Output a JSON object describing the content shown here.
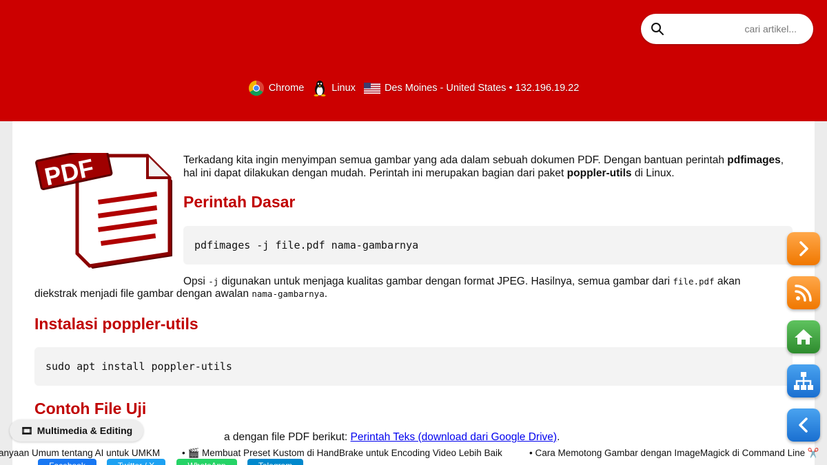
{
  "search": {
    "placeholder": "cari artikel..."
  },
  "visitor": {
    "browser": "Chrome",
    "os": "Linux",
    "location": "Des Moines - United States • 132.196.19.22"
  },
  "article": {
    "intro_text_1": "Terkadang kita ingin menyimpan semua gambar yang ada dalam sebuah dokumen PDF. Dengan bantuan perintah ",
    "intro_bold_1": "pdfimages",
    "intro_text_2": ", hal ini dapat dilakukan dengan mudah. Perintah ini merupakan bagian dari paket ",
    "intro_bold_2": "poppler-utils",
    "intro_text_3": " di Linux.",
    "heading_dasar": "Perintah Dasar",
    "code_dasar": "pdfimages -j file.pdf nama-gambarnya",
    "para2_t1": "Opsi ",
    "para2_c1": "-j",
    "para2_t2": " digunakan untuk menjaga kualitas gambar dengan format JPEG. Hasilnya, semua gambar dari ",
    "para2_c2": "file.pdf",
    "para2_t3": " akan",
    "para2_t4": "diekstrak menjadi file gambar dengan awalan ",
    "para2_c3": "nama-gambarnya",
    "para2_t5": ".",
    "heading_install": "Instalasi poppler-utils",
    "code_install": "sudo apt install poppler-utils",
    "heading_contoh": "Contoh File Uji",
    "para3_text": "a dengan file PDF berikut: ",
    "para3_link": "Perintah Teks (download dari Google Drive)",
    "para3_end": "."
  },
  "category_badge": {
    "icon": "🎞",
    "label": "Multimedia & Editing"
  },
  "ticker": [
    "anyaan Umum tentang AI untuk UMKM",
    "• 🎬 Membuat Preset Kustom di HandBrake untuk Encoding Video Lebih Baik",
    "• Cara Memotong Gambar dengan ImageMagick di Command Line ✂️"
  ],
  "share": {
    "facebook": "Facebook",
    "twitter": "Twitter / X",
    "whatsapp": "WhatsApp",
    "telegram": "Telegram"
  },
  "pdf_logo_text": "PDF",
  "colors": {
    "header": "#cc0000",
    "heading": "#c00000",
    "link": "#0000ee",
    "orange": "#f07800",
    "green": "#2e8b2e",
    "blue": "#1a6fd0"
  }
}
